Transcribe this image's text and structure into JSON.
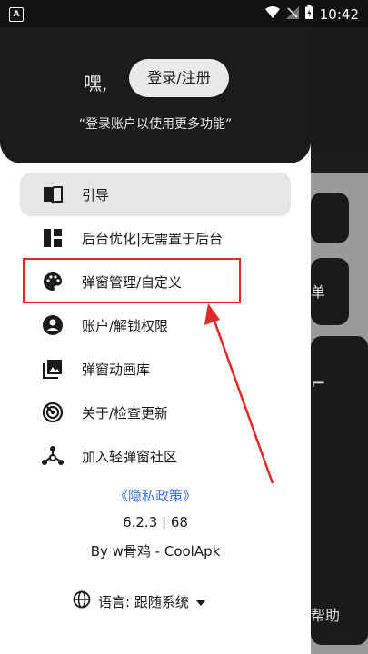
{
  "status_bar": {
    "left_icon": "A",
    "time": "10:42"
  },
  "drawer": {
    "greeting": "嘿,",
    "login_button": "登录/注册",
    "subtitle": "“登录账户以使用更多功能”",
    "menu": [
      {
        "label": "引导",
        "icon": "book-icon",
        "active": true
      },
      {
        "label": "后台优化|无需置于后台",
        "icon": "dashboard-icon"
      },
      {
        "label": "弹窗管理/自定义",
        "icon": "palette-icon"
      },
      {
        "label": "账户/解锁权限",
        "icon": "account-icon"
      },
      {
        "label": "弹窗动画库",
        "icon": "photo-library-icon"
      },
      {
        "label": "关于/检查更新",
        "icon": "radar-icon"
      },
      {
        "label": "加入轻弹窗社区",
        "icon": "community-icon"
      }
    ],
    "privacy_link": "《隐私政策》",
    "version": "6.2.3 | 68",
    "byline": "By w骨鸡 - CoolApk",
    "language_label": "语言: 跟随系统"
  },
  "background": {
    "card_text_1": "单",
    "card_text_2": "帮助"
  },
  "colors": {
    "highlight": "#e02a2a",
    "link": "#3b73d6"
  }
}
